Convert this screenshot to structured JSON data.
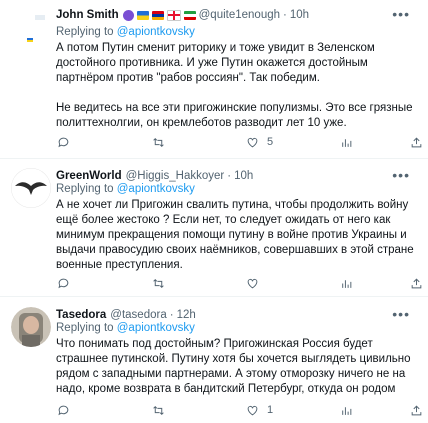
{
  "tweets": [
    {
      "name": "John Smith",
      "handle": "@quite1enough",
      "sep": "·",
      "time": "10h",
      "reply_prefix": "Replying to",
      "reply_to": "@apiontkovsky",
      "text": "А потом Путин сменит риторику и тоже увидит в Зеленском достойного противника. И уже Путин окажется достойным партнёром против \"рабов россиян\". Так победим.\n\nНе ведитесь на все эти пригожинские популизмы. Это все грязные политтехнолгии, он кремлеботов разводит лет 10 уже.",
      "likes": "5",
      "retweets": "",
      "replies": ""
    },
    {
      "name": "GreenWorld",
      "handle": "@Higgis_Hakkoyer",
      "sep": "·",
      "time": "10h",
      "reply_prefix": "Replying to",
      "reply_to": "@apiontkovsky",
      "text": "А не хочет ли Пригожин свалить путина, чтобы продолжить войну ещё более жестоко ? Если нет, то следует ожидать от него как минимум прекращения помощи путину в войне против Украины и выдачи правосудию своих наёмников, совершавших в этой стране военные преступления.",
      "likes": "",
      "retweets": "",
      "replies": ""
    },
    {
      "name": "Tasedora",
      "handle": "@tasedora",
      "sep": "·",
      "time": "12h",
      "reply_prefix": "Replying to",
      "reply_to": "@apiontkovsky",
      "text": "Что понимать под достойным? Пригожинская Россия будет страшнее путинской. Путину хотя бы хочется выглядеть цивильно рядом с западными партнерами. А этому отморозку ничего не на надо,  кроме возврата в бандитский Петербург, откуда он родом",
      "likes": "1",
      "retweets": "",
      "replies": ""
    }
  ],
  "icons": {
    "reply": "comment-icon",
    "retweet": "retweet-icon",
    "like": "heart-icon",
    "views": "views-icon",
    "share": "share-icon",
    "more": "more-icon"
  },
  "colors": {
    "link": "#1d9bf0",
    "secondary": "#536471",
    "text": "#0f1419"
  }
}
